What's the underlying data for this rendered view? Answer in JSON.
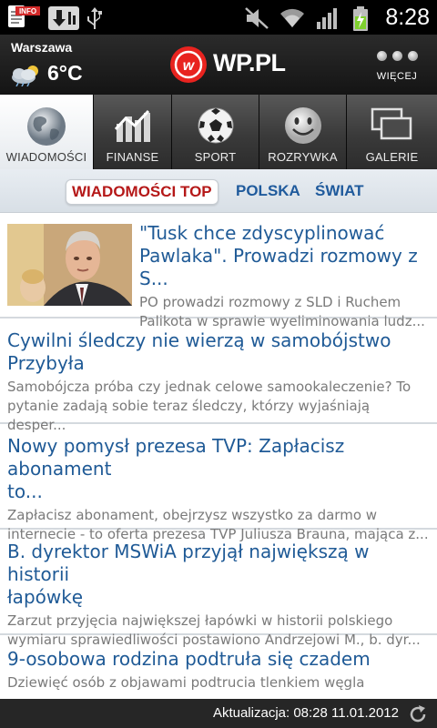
{
  "status_bar": {
    "time": "8:28",
    "icons": [
      "news-app-icon",
      "download-icon",
      "usb-icon",
      "mute-icon",
      "wifi-icon",
      "signal-icon",
      "battery-icon"
    ],
    "info_badge": "INFO"
  },
  "header": {
    "city": "Warszawa",
    "temperature": "6°C",
    "weather_icon": "cloud-sun-icon",
    "logo_text": "WP.PL",
    "more_label": "WIĘCEJ",
    "accent": "#e8231f"
  },
  "categories": [
    {
      "label": "WIADOMOŚCI",
      "icon": "globe-icon",
      "active": true
    },
    {
      "label": "FINANSE",
      "icon": "chart-icon",
      "active": false
    },
    {
      "label": "SPORT",
      "icon": "soccer-ball-icon",
      "active": false
    },
    {
      "label": "ROZRYWKA",
      "icon": "smiley-icon",
      "active": false
    },
    {
      "label": "GALERIE",
      "icon": "gallery-icon",
      "active": false
    }
  ],
  "subnav": [
    {
      "label": "WIADOMOŚCI TOP",
      "active": true
    },
    {
      "label": "POLSKA",
      "active": false
    },
    {
      "label": "ŚWIAT",
      "active": false
    }
  ],
  "articles": [
    {
      "title_lines": [
        "\"Tusk chce zdyscyplinować",
        "Pawlaka\". Prowadzi rozmowy z S..."
      ],
      "summary_lines": [
        "PO prowadzi rozmowy z SLD i Ruchem",
        "Palikota w sprawie wyeliminowania ludz..."
      ],
      "has_image": true
    },
    {
      "title_lines": [
        "Cywilni śledczy nie wierzą w samobójstwo",
        "Przybyła"
      ],
      "summary_lines": [
        "Samobójcza próba czy jednak celowe samookaleczenie? To",
        "pytanie zadają sobie teraz śledczy, którzy wyjaśniają desper..."
      ]
    },
    {
      "title_lines": [
        "Nowy pomysł prezesa TVP: Zapłacisz abonament",
        "to..."
      ],
      "summary_lines": [
        "Zapłacisz abonament, obejrzysz wszystko za darmo w",
        "internecie - to oferta prezesa TVP Juliusza Brauna, mająca z..."
      ]
    },
    {
      "title_lines": [
        "B. dyrektor MSWiA przyjął największą w historii",
        "łapówkę"
      ],
      "summary_lines": [
        "Zarzut przyjęcia największej łapówki w historii polskiego",
        "wymiaru sprawiedliwości postawiono Andrzejowi M., b. dyr..."
      ]
    },
    {
      "title_lines": [
        "9-osobowa rodzina podtruła się czadem"
      ],
      "summary_lines": [
        "Dziewięć osób z objawami podtrucia tlenkiem węgla"
      ]
    }
  ],
  "footer": {
    "update_text": "Aktualizacja: 08:28 11.01.2012",
    "refresh_icon": "refresh-icon"
  }
}
